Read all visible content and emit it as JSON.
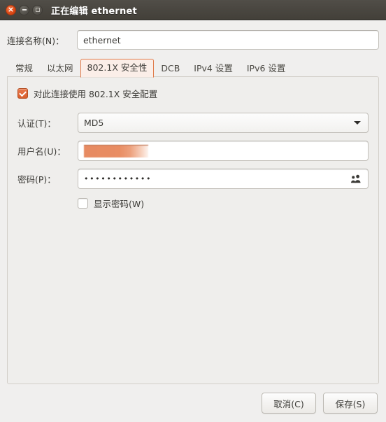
{
  "window": {
    "title": "正在编辑 ethernet",
    "controls": [
      {
        "name": "close",
        "glyph": "×"
      },
      {
        "name": "minimize",
        "glyph": "–"
      },
      {
        "name": "maximize",
        "glyph": "□"
      }
    ]
  },
  "connection": {
    "name_label": "连接名称(N)：",
    "name_value": "ethernet",
    "name_placeholder": "ethernet"
  },
  "tabs": [
    {
      "label": "常规",
      "active": false
    },
    {
      "label": "以太网",
      "active": false
    },
    {
      "label": "802.1X 安全性",
      "active": true
    },
    {
      "label": "DCB",
      "active": false
    },
    {
      "label": "IPv4 设置",
      "active": false
    },
    {
      "label": "IPv6 设置",
      "active": false
    }
  ],
  "security": {
    "enable_label": "对此连接使用 802.1X 安全配置",
    "enable_checked": true,
    "auth_label": "认证(T)：",
    "auth_value": "MD5",
    "auth_options": [
      "MD5"
    ],
    "username_label": "用户名(U)：",
    "username_value": "",
    "username_redacted": true,
    "password_label": "密码(P)：",
    "password_value": "••••••••••••",
    "password_icon": "people-icon",
    "show_password_label": "显示密码(W)",
    "show_password_checked": false
  },
  "actions": {
    "cancel_label": "取消(C)",
    "save_label": "保存(S)"
  },
  "colors": {
    "accent": "#dd4814",
    "titlebar": "#4a4741",
    "active_tab_border": "#e07b4b",
    "active_tab_bg": "#fbeee8",
    "redaction": "#e78b62"
  }
}
